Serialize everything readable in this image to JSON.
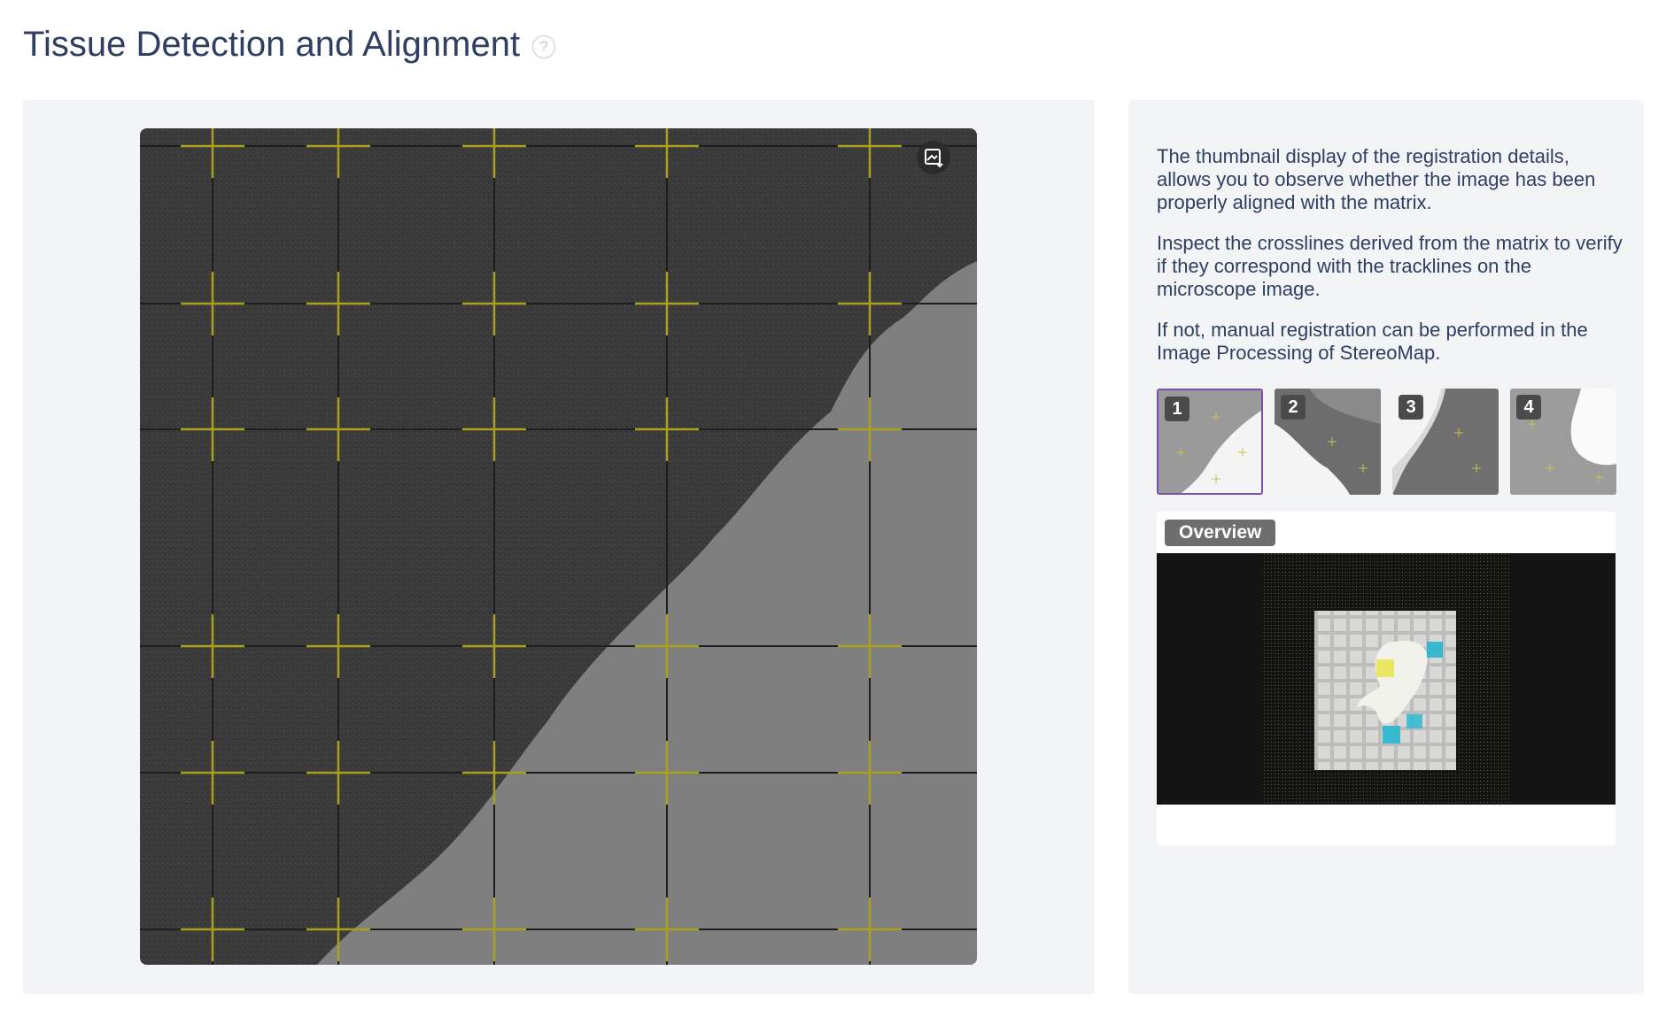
{
  "page": {
    "title": "Tissue Detection and Alignment",
    "help_icon": "question-circle-icon"
  },
  "viewer": {
    "export_icon": "image-export-icon"
  },
  "description": {
    "p1": "The thumbnail display of the registration details, allows you to observe whether the image has been properly aligned with the matrix.",
    "p2": "Inspect the crosslines derived from the matrix to verify if they correspond with the tracklines on the microscope image.",
    "p3": "If not, manual registration can be performed in the Image Processing of StereoMap."
  },
  "thumbnails": [
    {
      "number": "1",
      "selected": true
    },
    {
      "number": "2",
      "selected": false
    },
    {
      "number": "3",
      "selected": false
    },
    {
      "number": "4",
      "selected": false
    }
  ],
  "overview": {
    "label": "Overview"
  },
  "colors": {
    "title": "#2f3f62",
    "crossline": "#a8a21a",
    "selected_border": "#7b4fb3",
    "panel_bg": "#f3f4f6"
  }
}
